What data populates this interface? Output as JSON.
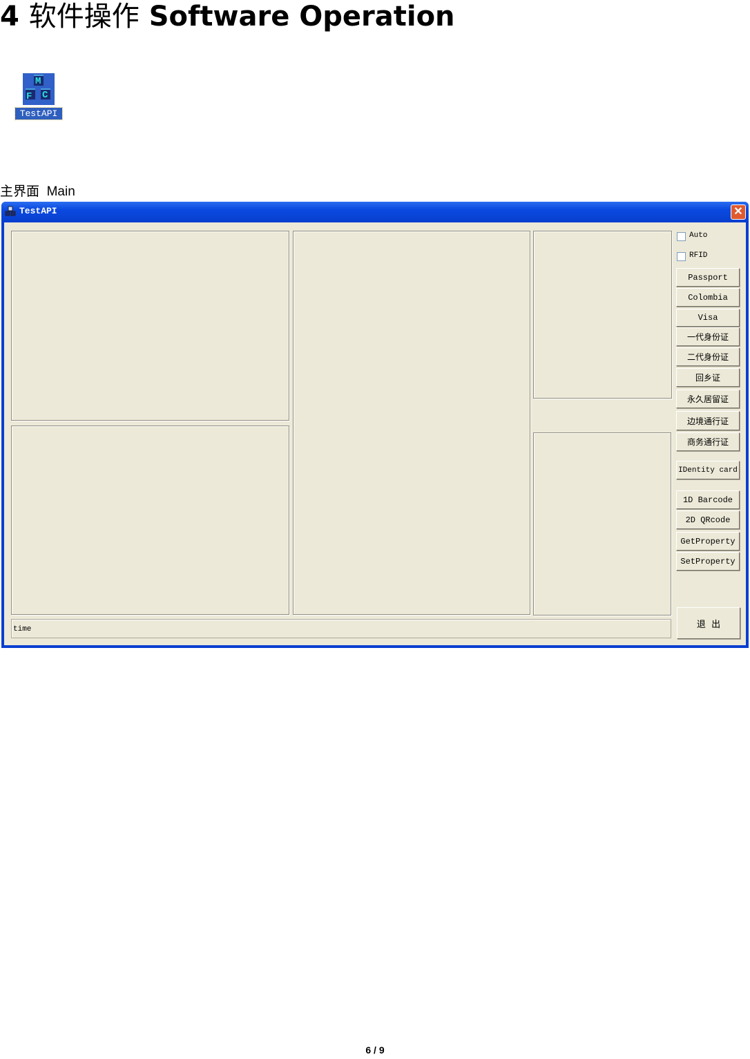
{
  "document": {
    "heading_number": "4",
    "heading_cn": "软件操作",
    "heading_en": "Software Operation",
    "desktop_icon_label": "TestAPI",
    "caption_cn": "主界面",
    "caption_en": "Main",
    "page_indicator": "6 / 9"
  },
  "window": {
    "title": "TestAPI",
    "close_symbol": "✕",
    "checkboxes": [
      {
        "label": "Auto",
        "checked": false
      },
      {
        "label": "RFID",
        "checked": false
      }
    ],
    "buttons": [
      "Passport",
      "Colombia",
      "Visa",
      "一代身份证",
      "二代身份证",
      "回乡证",
      "永久居留证",
      "边境通行证",
      "商务通行证",
      "IDentity card",
      "1D Barcode",
      "2D QRcode",
      "GetProperty",
      "SetProperty"
    ],
    "exit_label": "退  出",
    "status_text": "time"
  }
}
